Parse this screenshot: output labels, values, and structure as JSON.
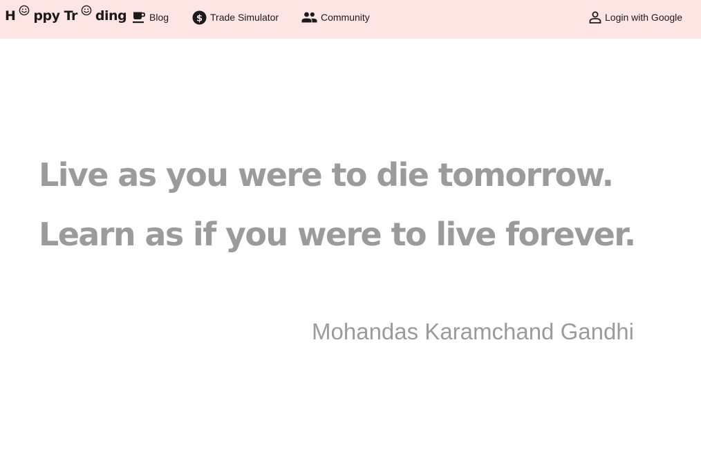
{
  "navbar": {
    "brand": {
      "part1": "H",
      "part2": "ppy Tr",
      "part3": "ding",
      "smile_glyph": "☺",
      "smile_icon": "smiley-face-icon"
    },
    "items": [
      {
        "label": "Blog",
        "icon": "coffee-cup-icon"
      },
      {
        "label": "Trade Simulator",
        "icon": "dollar-coin-icon"
      },
      {
        "label": "Community",
        "icon": "people-icon"
      }
    ],
    "login": {
      "label": "Login with Google",
      "icon": "person-outline-icon"
    }
  },
  "quote": {
    "line1": "Live as you were to die tomorrow.",
    "line2": "Learn as if you were to live forever.",
    "author": "Mohandas Karamchand Gandhi"
  },
  "colors": {
    "navbar_bg": "#fde5e4",
    "quote_text": "#9b9b9b",
    "nav_text": "#1a1a1a"
  }
}
